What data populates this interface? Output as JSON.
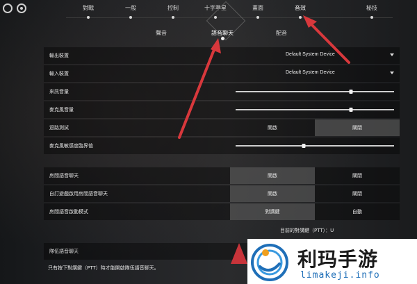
{
  "nav": {
    "tabs": [
      {
        "label": "對戰"
      },
      {
        "label": "一般"
      },
      {
        "label": "控制"
      },
      {
        "label": "十字準星"
      },
      {
        "label": "畫面"
      },
      {
        "label": "音效"
      },
      {
        "label": "秘技"
      }
    ],
    "active_tab": "音效"
  },
  "subnav": {
    "tabs": [
      {
        "label": "聲音"
      },
      {
        "label": "語音聊天"
      },
      {
        "label": "配音"
      }
    ],
    "active_subtab": "語音聊天"
  },
  "settings": {
    "output_device": {
      "label": "輸出裝置",
      "value": "Default System Device"
    },
    "input_device": {
      "label": "輸入裝置",
      "value": "Default System Device"
    },
    "incoming_volume": {
      "label": "來訊音量",
      "level": 0.73
    },
    "mic_volume": {
      "label": "麥克風音量",
      "level": 0.73
    },
    "loopback_test": {
      "label": "迴路測試",
      "on": "開啟",
      "off": "關閉",
      "selected": "關閉"
    },
    "mic_sensitivity": {
      "label": "麥克風敏感度臨界值",
      "level": 0.43
    },
    "party_voice": {
      "label": "房間語音聊天",
      "on": "開啟",
      "off": "關閉",
      "selected": "開啟"
    },
    "auto_join_party": {
      "label": "自訂遊戲啟用房間語音聊天",
      "on": "開啟",
      "off": "關閉",
      "selected": "開啟"
    },
    "party_mode": {
      "label": "房間語音啟動模式",
      "opt_a": "對講鍵",
      "opt_b": "自動",
      "selected": "對講鍵"
    },
    "ptt_key": {
      "text": "目前的對講鍵（PTT）：U"
    },
    "team_voice": {
      "label": "隊伍語音聊天"
    },
    "team_note": {
      "text": "只有按下對講鍵（PTT）時才能開啟隊伍語音聊天。"
    }
  },
  "watermark": {
    "cn": "利玛手游",
    "en": "limakeji.info"
  },
  "colors": {
    "arrow": "#d8383c",
    "selected_option": "#6e6e6e"
  }
}
